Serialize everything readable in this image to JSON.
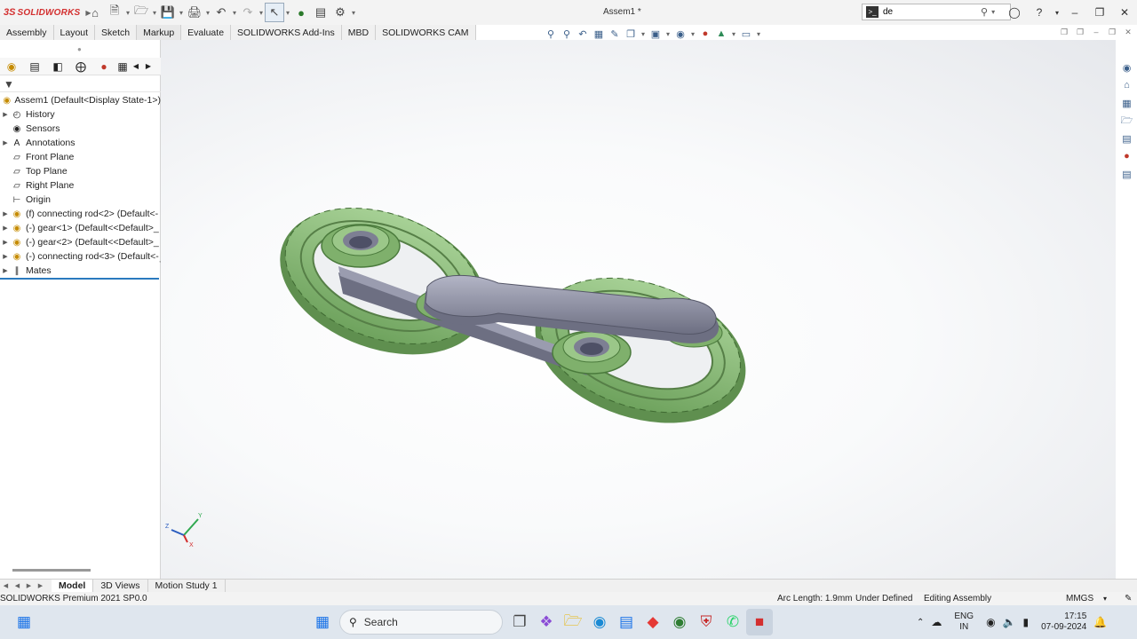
{
  "app": {
    "logo_ds": "3S",
    "logo_text": "SOLIDWORKS",
    "document_title": "Assem1 *",
    "search_value": "de",
    "search_placeholder": ""
  },
  "command_tabs": [
    "Assembly",
    "Layout",
    "Sketch",
    "Markup",
    "Evaluate",
    "SOLIDWORKS Add-Ins",
    "MBD",
    "SOLIDWORKS CAM"
  ],
  "active_command_tab": "Markup",
  "tree": {
    "root": "Assem1  (Default<Display State-1>)",
    "items": [
      {
        "label": "History",
        "icon": "history-icon",
        "expandable": true
      },
      {
        "label": "Sensors",
        "icon": "sensors-icon",
        "expandable": false
      },
      {
        "label": "Annotations",
        "icon": "annotations-icon",
        "expandable": true
      },
      {
        "label": "Front Plane",
        "icon": "plane-icon",
        "expandable": false
      },
      {
        "label": "Top Plane",
        "icon": "plane-icon",
        "expandable": false
      },
      {
        "label": "Right Plane",
        "icon": "plane-icon",
        "expandable": false
      },
      {
        "label": "Origin",
        "icon": "origin-icon",
        "expandable": false
      },
      {
        "label": "(f) connecting rod<2> (Default<-",
        "icon": "part-icon",
        "expandable": true
      },
      {
        "label": "(-) gear<1> (Default<<Default>_",
        "icon": "part-icon",
        "expandable": true
      },
      {
        "label": "(-) gear<2> (Default<<Default>_",
        "icon": "part-icon",
        "expandable": true
      },
      {
        "label": "(-) connecting rod<3> (Default<-",
        "icon": "part-icon",
        "expandable": true
      },
      {
        "label": "Mates",
        "icon": "mates-icon",
        "expandable": true
      }
    ]
  },
  "triad": {
    "x_label": "X",
    "y_label": "Y",
    "z_label": "Z"
  },
  "bottom_tabs": [
    "Model",
    "3D Views",
    "Motion Study 1"
  ],
  "active_bottom_tab": "Model",
  "status": {
    "product": "SOLIDWORKS Premium 2021 SP0.0",
    "arc_length": "Arc Length: 1.9mm",
    "definition": "Under Defined",
    "mode": "Editing Assembly",
    "units": "MMGS"
  },
  "taskbar": {
    "search_label": "Search",
    "lang_line1": "ENG",
    "lang_line2": "IN",
    "time": "17:15",
    "date": "07-09-2024"
  },
  "colors": {
    "gear_green": "#8fc07a",
    "rod_gray": "#8d8fa3",
    "accent_blue": "#2a7abf",
    "brand_red": "#d32f2f"
  }
}
